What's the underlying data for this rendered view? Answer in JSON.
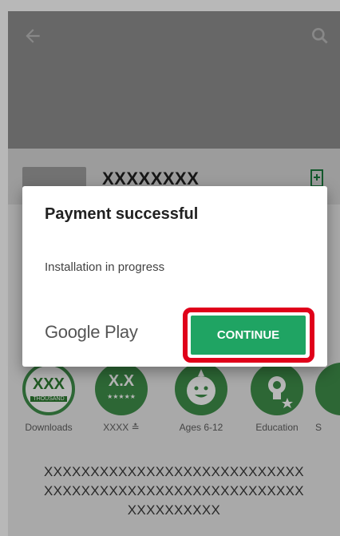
{
  "app": {
    "title": "XXXXXXXX"
  },
  "dialog": {
    "title": "Payment successful",
    "message": "Installation in progress",
    "logo_text": "Google Play",
    "continue_label": "CONTINUE"
  },
  "stats": [
    {
      "badge": "XXX",
      "badge_sub": "THOUSAND",
      "label": "Downloads",
      "icon": "downloads-badge-icon"
    },
    {
      "badge": "X.X",
      "badge_sub": "★★★★★",
      "label": "XXXX ≛",
      "icon": "rating-badge-icon"
    },
    {
      "badge": "",
      "label": "Ages 6-12",
      "icon": "ages-smiley-icon"
    },
    {
      "badge": "",
      "label": "Education",
      "icon": "education-bulb-icon"
    },
    {
      "badge": "",
      "label": "S",
      "icon": "similar-icon"
    }
  ],
  "description": {
    "line1": "XXXXXXXXXXXXXXXXXXXXXXXXXXXX",
    "line2": "XXXXXXXXXXXXXXXXXXXXXXXXXXXX",
    "line3": "XXXXXXXXXX"
  },
  "colors": {
    "accent_green": "#1fa463",
    "highlight_red": "#e0001a",
    "stat_green": "#3f8f4a"
  }
}
